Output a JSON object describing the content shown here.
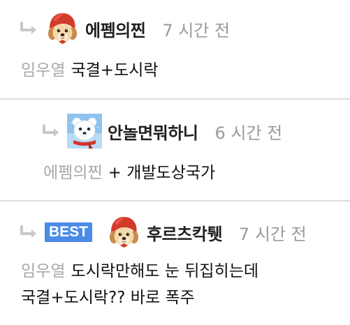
{
  "comments": [
    {
      "reply_icon": "reply-arrow-icon",
      "avatar_icon": "puppy-red-hood-avatar-icon",
      "nickname": "에펨의찐",
      "time": "7 시간 전",
      "mention": "임우열",
      "text": "국결+도시락"
    },
    {
      "reply_icon": "reply-arrow-icon",
      "avatar_icon": "polar-bear-avatar-icon",
      "nickname": "안놀면뭐하니",
      "time": "6 시간 전",
      "mention": "에펨의찐",
      "text": "+ 개발도상국가"
    },
    {
      "reply_icon": "reply-arrow-icon",
      "badge": "BEST",
      "avatar_icon": "puppy-red-hood-avatar-icon",
      "nickname": "후르츠칵퉷",
      "time": "7 시간 전",
      "mention": "임우열",
      "text_line1": "도시락만해도 눈 뒤집히는데",
      "text_line2": "국결+도시락?? 바로 폭주"
    }
  ],
  "colors": {
    "badge_bg": "#4a8be8",
    "mention": "#a8a8a8",
    "time": "#9a9a9a",
    "divider": "#dcdcdc",
    "reply_arrow": "#c8c8c8"
  }
}
